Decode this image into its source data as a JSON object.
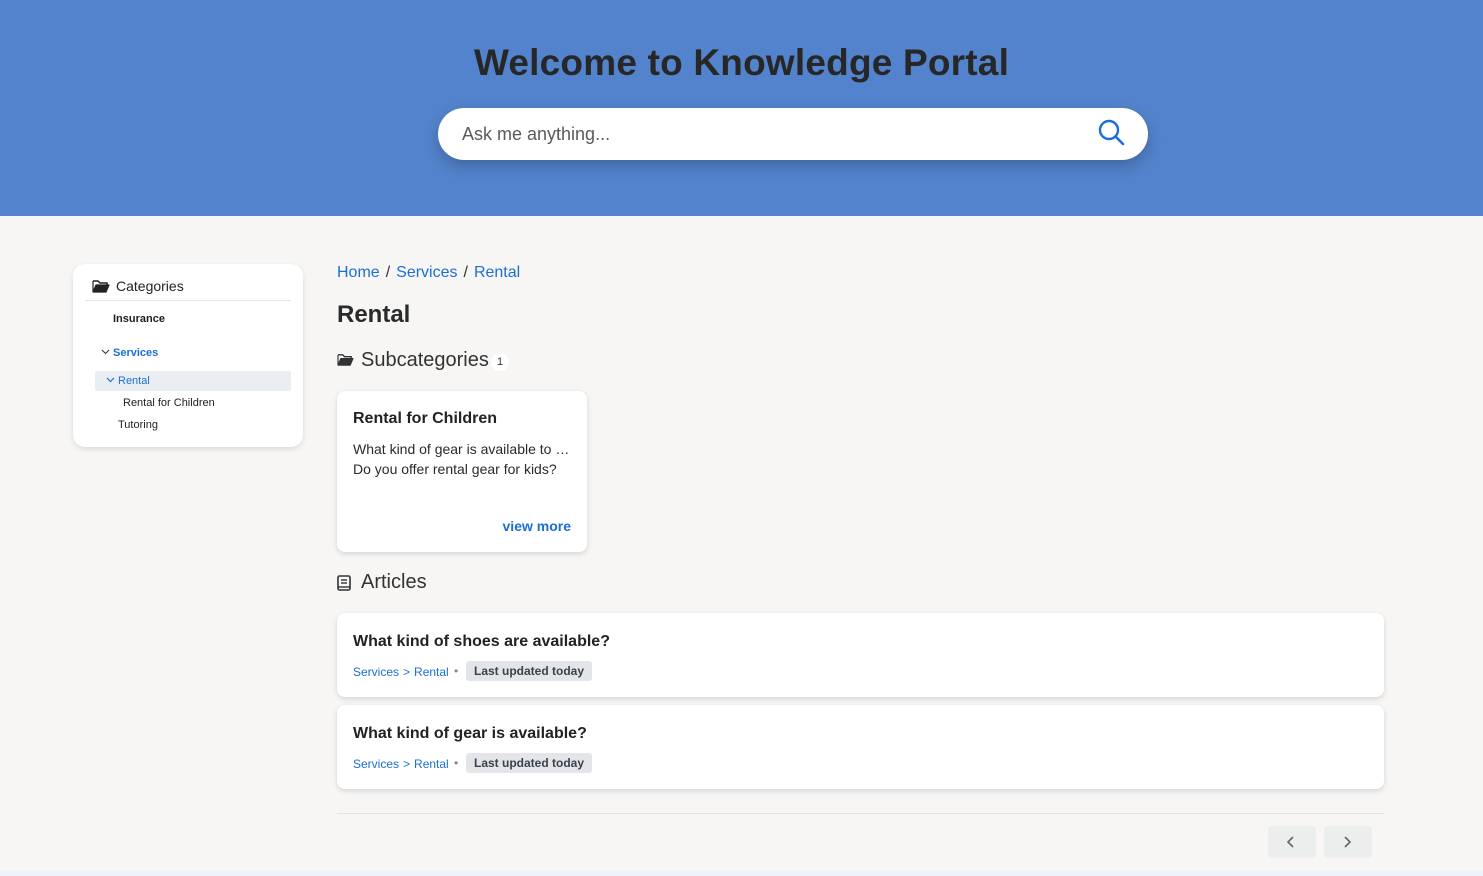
{
  "hero": {
    "title": "Welcome to Knowledge Portal",
    "search_placeholder": "Ask me anything...",
    "background_color": "#5383cc",
    "search_icon": "search-icon"
  },
  "sidebar": {
    "heading": "Categories",
    "heading_icon": "folder-open-icon",
    "items": [
      {
        "label": "Insurance",
        "expanded": false,
        "selected": false
      },
      {
        "label": "Services",
        "expanded": true,
        "selected": false
      },
      {
        "label": "Rental",
        "expanded": true,
        "selected": true
      },
      {
        "label": "Rental for Children",
        "expanded": false,
        "selected": false
      },
      {
        "label": "Tutoring",
        "expanded": false,
        "selected": false
      }
    ]
  },
  "breadcrumb": {
    "items": [
      "Home",
      "Services",
      "Rental"
    ],
    "separator": "/"
  },
  "page_title": "Rental",
  "subcategories": {
    "heading": "Subcategories",
    "count": "1",
    "cards": [
      {
        "title": "Rental for Children",
        "questions": [
          "What kind of gear is available to rent for children?",
          "Do you offer rental gear for kids?"
        ],
        "more_label": "view more"
      }
    ]
  },
  "articles": {
    "heading": "Articles",
    "items": [
      {
        "title": "What kind of shoes are available?",
        "path": [
          "Services",
          "Rental"
        ],
        "path_separator": ">",
        "updated": "Last updated today"
      },
      {
        "title": "What kind of gear is available?",
        "path": [
          "Services",
          "Rental"
        ],
        "path_separator": ">",
        "updated": "Last updated today"
      }
    ]
  },
  "pagination": {
    "prev_icon": "chevron-left-icon",
    "next_icon": "chevron-right-icon"
  },
  "colors": {
    "accent": "#1a6fd6",
    "page_background": "#f7f6f5"
  }
}
